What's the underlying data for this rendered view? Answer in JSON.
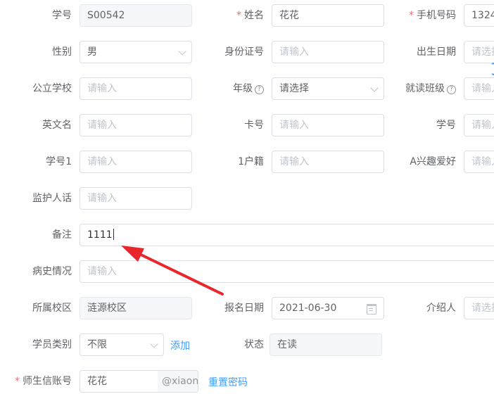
{
  "form": {
    "student_no_label": "学号",
    "student_no_value": "S00542",
    "name_label": "姓名",
    "name_value": "花花",
    "phone_label": "手机号码",
    "phone_value": "1324",
    "gender_label": "性别",
    "gender_value": "男",
    "id_card_label": "身份证号",
    "birth_label": "出生日期",
    "public_school_label": "公立学校",
    "grade_label": "年级",
    "grade_placeholder": "请选择",
    "class_label": "就读班级",
    "english_name_label": "英文名",
    "card_no_label": "卡号",
    "student_no2_label": "学号",
    "student_no3_label": "学号1",
    "household_label": "1户籍",
    "hobby_label": "A兴趣爱好",
    "guardian_label": "监护人话",
    "remark_label": "备注",
    "remark_value": "1111",
    "medical_label": "病史情况",
    "campus_label": "所属校区",
    "campus_value": "涟源校区",
    "enroll_date_label": "报名日期",
    "enroll_date_value": "2021-06-30",
    "referrer_label": "介绍人",
    "category_label": "学员类别",
    "category_value": "不限",
    "add_link": "添加",
    "status_label": "状态",
    "status_value": "在读",
    "account_label": "师生信账号",
    "account_value": "花花",
    "account_suffix": "@xiaon",
    "reset_password": "重置密码",
    "placeholder_input": "请输入",
    "placeholder_select_trunc": "请选择",
    "placeholder_input_trunc": "请输入"
  },
  "colors": {
    "required": "#f56c6c",
    "link": "#409eff",
    "annotation_arrow": "#e8262b"
  }
}
